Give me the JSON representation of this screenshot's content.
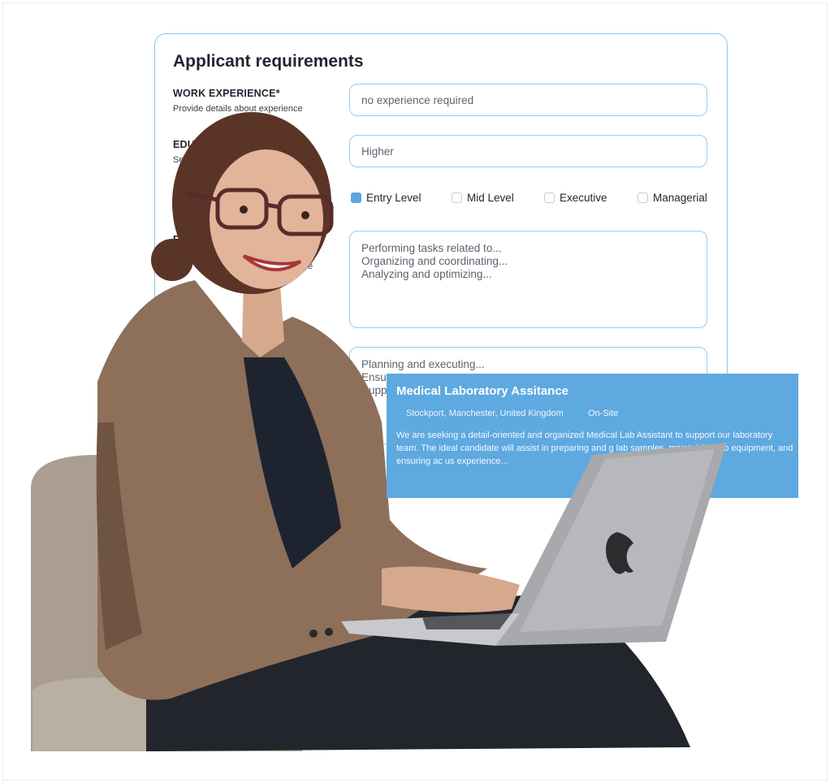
{
  "form": {
    "title": "Applicant requirements",
    "work_experience": {
      "label": "WORK EXPERIENCE*",
      "hint": "Provide details about experience",
      "value": "no experience required"
    },
    "education": {
      "label": "EDUC",
      "hint": "Sele",
      "value": "Higher"
    },
    "type": {
      "label": "T",
      "hint": "P",
      "options": [
        {
          "label": "Entry Level",
          "checked": true
        },
        {
          "label": "Mid Level",
          "checked": false
        },
        {
          "label": "Executive",
          "checked": false
        },
        {
          "label": "Managerial",
          "checked": false
        }
      ]
    },
    "responsibilities": {
      "label": "RE",
      "hint": "e",
      "lines": [
        "Performing tasks related to...",
        "Organizing and coordinating...",
        "Analyzing and optimizing..."
      ]
    },
    "goals": {
      "lines": [
        "Planning and executing...",
        "Ensu",
        "Supp"
      ]
    }
  },
  "job_card": {
    "title": "Medical Laboratory Assitance",
    "location": "Stockport, Manchester, United Kingdom",
    "work_type": "On-Site",
    "description": "We are seeking a detail-oriented and organized Medical Lab Assistant to support our laboratory team. The ideal candidate will assist in preparing and g lab samples, maintaining lab equipment, and ensuring ac us experience..."
  },
  "colors": {
    "accent": "#5ea9e0",
    "field_border": "#9ccbee",
    "card_border": "#8fc2e8"
  }
}
